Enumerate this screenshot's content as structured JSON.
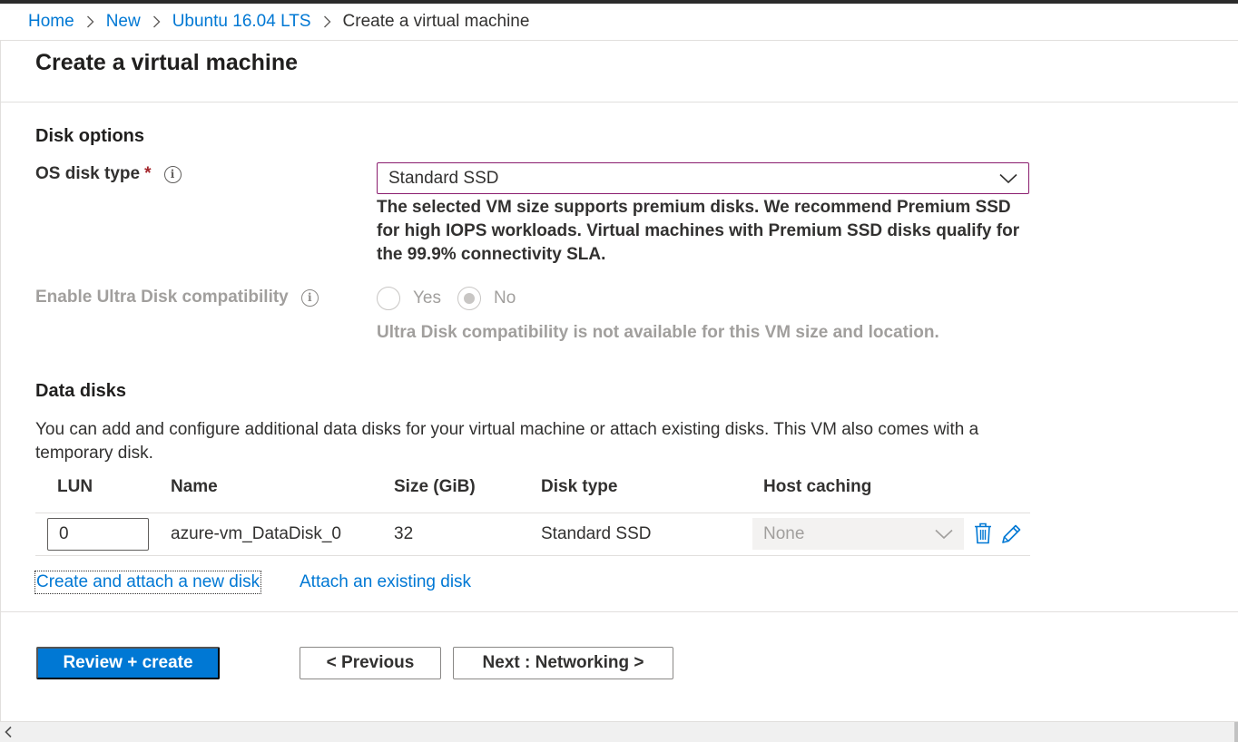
{
  "breadcrumb": {
    "items": [
      "Home",
      "New",
      "Ubuntu 16.04 LTS"
    ],
    "current": "Create a virtual machine"
  },
  "page": {
    "title": "Create a virtual machine"
  },
  "disk_options": {
    "section_title": "Disk options",
    "os_disk_type": {
      "label": "OS disk type",
      "required_marker": "*",
      "value": "Standard SSD",
      "help": "The selected VM size supports premium disks. We recommend Premium SSD for high IOPS workloads. Virtual machines with Premium SSD disks qualify for the 99.9% connectivity SLA."
    },
    "ultra_disk": {
      "label": "Enable Ultra Disk compatibility",
      "options": [
        "Yes",
        "No"
      ],
      "selected": "No",
      "note": "Ultra Disk compatibility is not available for this VM size and location."
    }
  },
  "data_disks": {
    "section_title": "Data disks",
    "description": "You can add and configure additional data disks for your virtual machine or attach existing disks. This VM also comes with a temporary disk.",
    "columns": [
      "LUN",
      "Name",
      "Size (GiB)",
      "Disk type",
      "Host caching"
    ],
    "rows": [
      {
        "lun": "0",
        "name": "azure-vm_DataDisk_0",
        "size": "32",
        "disk_type": "Standard SSD",
        "host_caching": "None"
      }
    ],
    "create_link": "Create and attach a new disk",
    "attach_link": "Attach an existing disk"
  },
  "footer": {
    "review_create": "Review + create",
    "previous": "< Previous",
    "next": "Next : Networking >"
  },
  "colors": {
    "accent": "#0078d4",
    "required": "#a4262c",
    "dropdown_border": "#8a1c6e",
    "disabled_text": "#a19f9d"
  },
  "icons": [
    "chevron-right-icon",
    "chevron-down-icon",
    "info-icon",
    "delete-icon",
    "edit-icon",
    "scroll-left-icon"
  ]
}
